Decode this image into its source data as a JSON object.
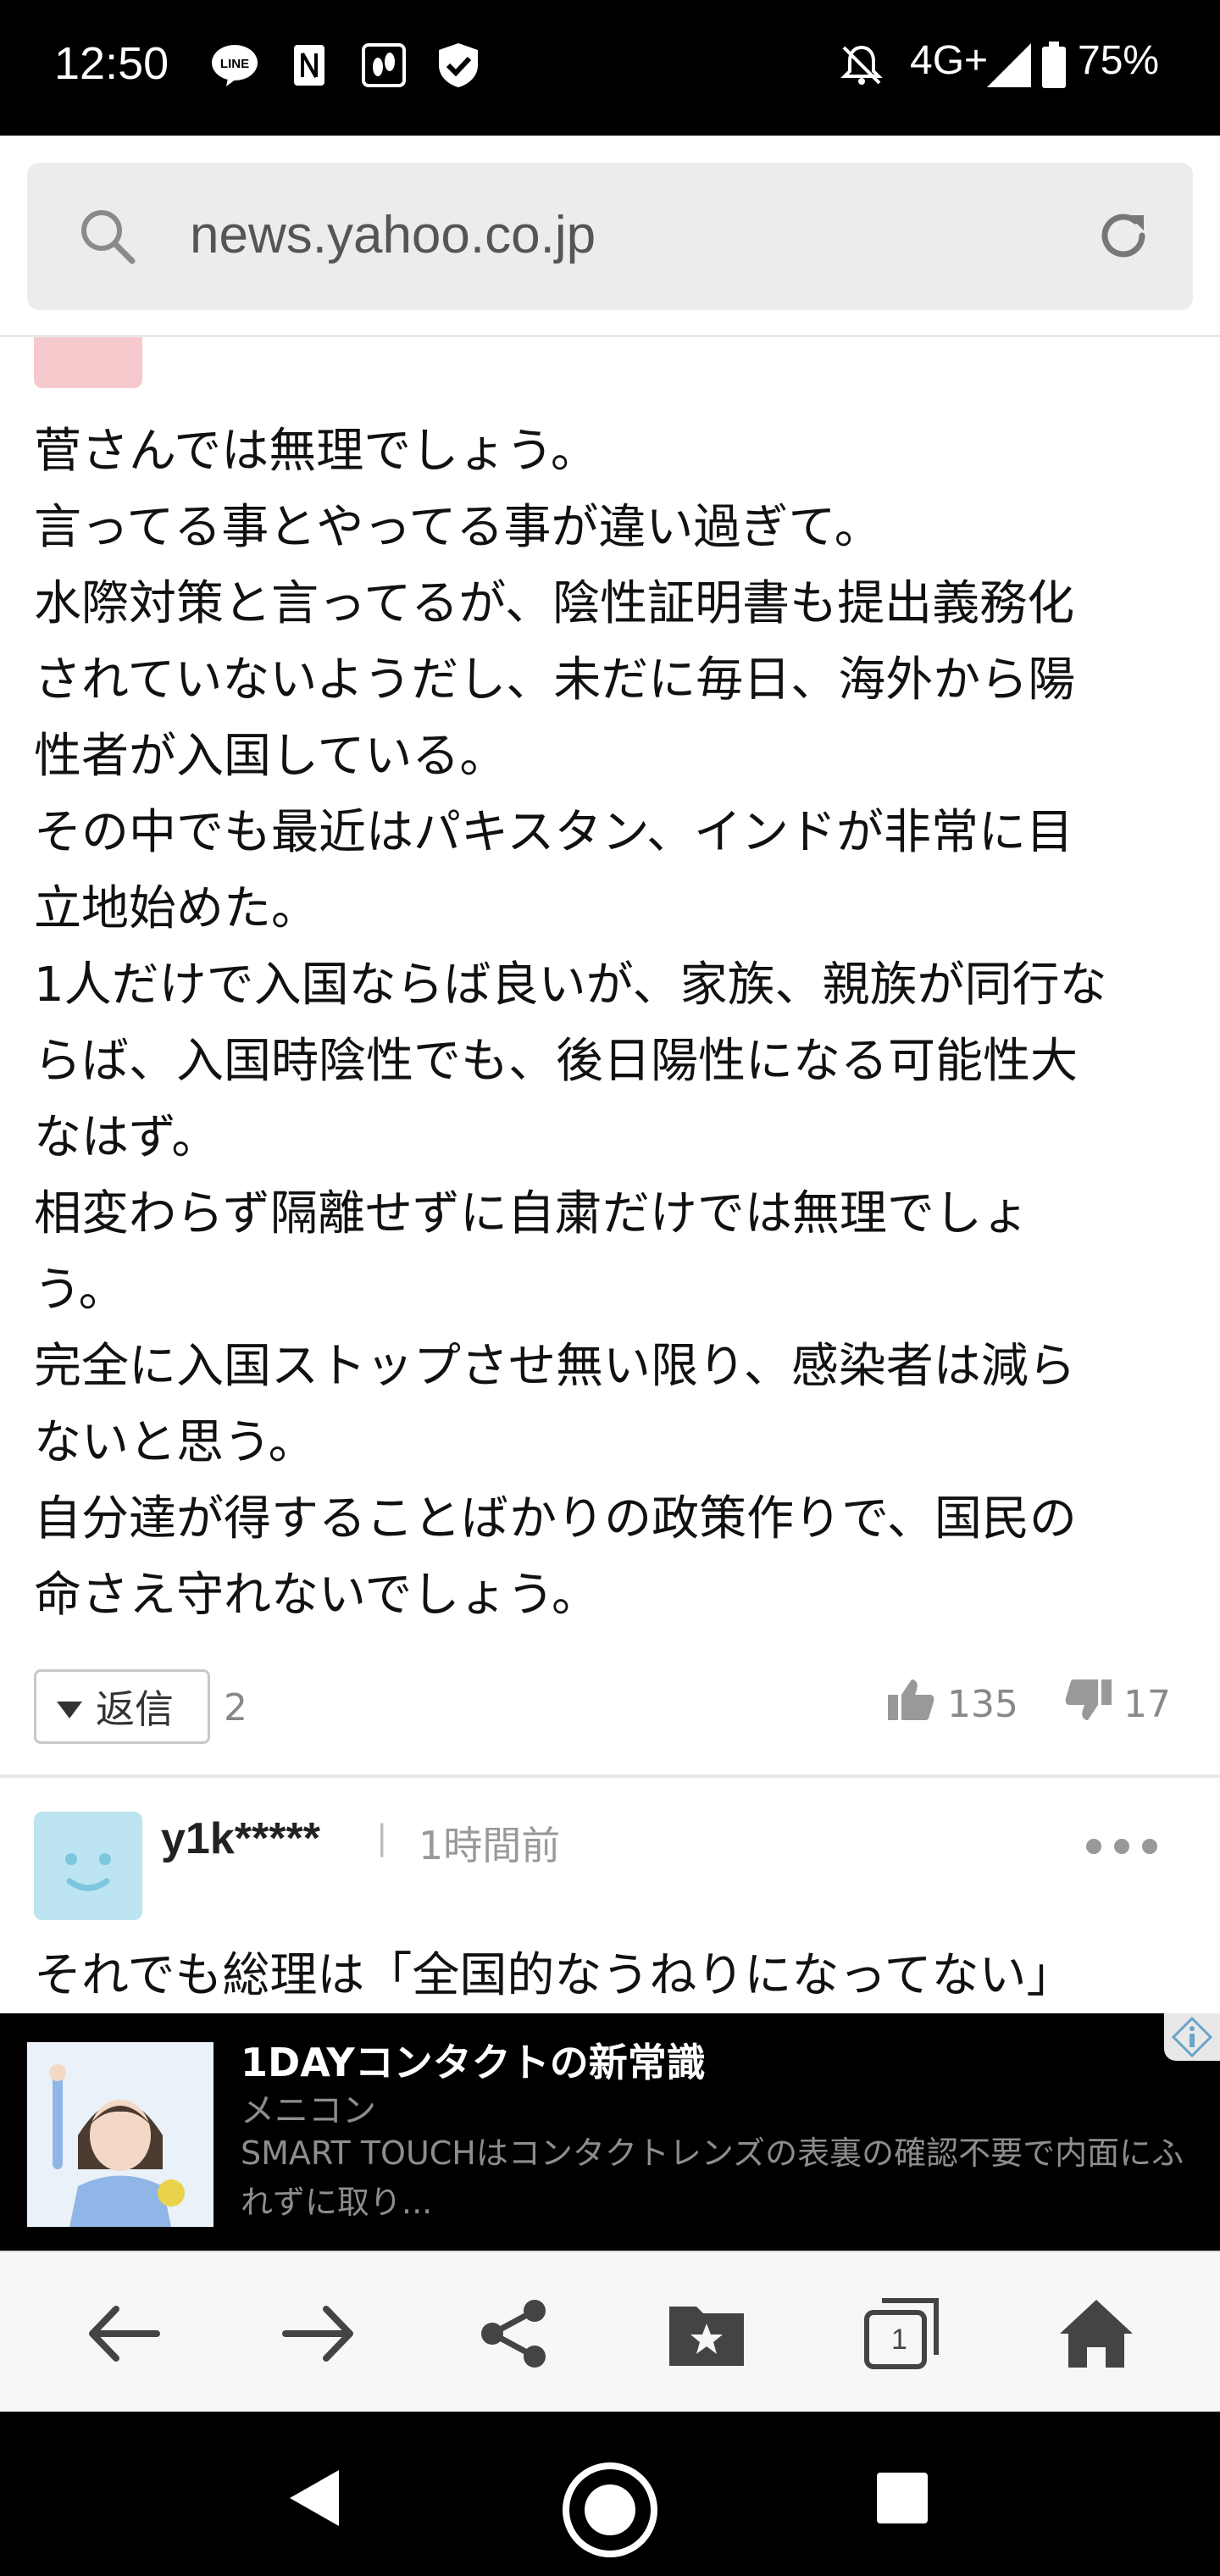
{
  "status_bar": {
    "time": "12:50",
    "network": "4G+",
    "battery": "75%",
    "app_icons": [
      "line-icon",
      "notification-app-icon",
      "foot-app-icon",
      "shield-icon"
    ]
  },
  "url_bar": {
    "url": "news.yahoo.co.jp"
  },
  "comment": {
    "lines": [
      "菅さんでは無理でしょう。",
      "言ってる事とやってる事が違い過ぎて。",
      "水際対策と言ってるが、陰性証明書も提出義務化",
      "されていないようだし、未だに毎日、海外から陽",
      "性者が入国している。",
      "その中でも最近はパキスタン、インドが非常に目",
      "立地始めた。",
      "1人だけで入国ならば良いが、家族、親族が同行な",
      "らば、入国時陰性でも、後日陽性になる可能性大",
      "なはず。",
      "相変わらず隔離せずに自粛だけでは無理でしょ",
      "う。",
      "完全に入国ストップさせ無い限り、感染者は減ら",
      "ないと思う。",
      "自分達が得することばかりの政策作りで、国民の",
      "命さえ守れないでしょう。"
    ],
    "reply_label": "返信",
    "reply_count": "2",
    "likes": "135",
    "dislikes": "17"
  },
  "comment2": {
    "username": "y1k*****",
    "separator": "|",
    "time_ago": "1時間前",
    "text_preview": "それでも総理は「全国的なうねりになってない」"
  },
  "ad": {
    "title": "1DAYコンタクトの新常識",
    "brand": "メニコン",
    "description": "SMART TOUCHはコンタクトレンズの表裏の確認不要で内面にふれずに取り..."
  },
  "toolbar": {
    "tab_count": "1"
  },
  "colors": {
    "avatar1": "#f6c9cc",
    "avatar2": "#bde4f1",
    "muted_text": "#888888"
  }
}
